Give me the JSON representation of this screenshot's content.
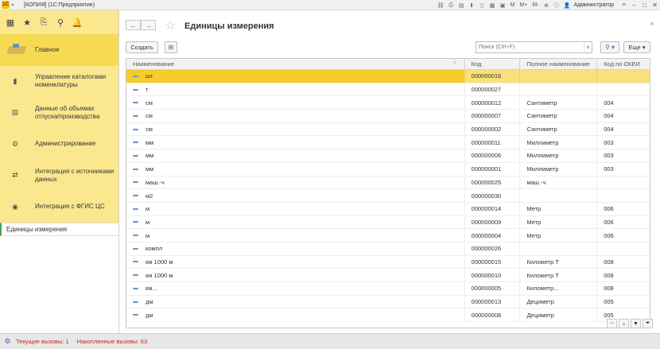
{
  "app": {
    "window_title": "[КОПИЯ]  (1С:Предприятие)",
    "user": "Администратор",
    "m_label": "M",
    "m_plus": "M+",
    "m_minus": "M-"
  },
  "sections": [
    {
      "icon": "home-logo-icon",
      "label": "Главное",
      "active": true
    },
    {
      "icon": "catalog-icon",
      "label": "Управление каталогами номенклатуры",
      "active": false
    },
    {
      "icon": "document-icon",
      "label": "Данные об объемах отпуска/производства",
      "active": false
    },
    {
      "icon": "gear-icon",
      "label": "Администрирование",
      "active": false
    },
    {
      "icon": "integration-icon",
      "label": "Интеграция с источниками данных",
      "active": false
    },
    {
      "icon": "fgis-icon",
      "label": "Интеграция с ФГИС ЦС",
      "active": false
    }
  ],
  "open_windows": [
    {
      "label": "Единицы измерения"
    }
  ],
  "form": {
    "title": "Единицы измерения",
    "create_label": "Создать",
    "search_placeholder": "Поиск (Ctrl+F)",
    "more_label": "Еще"
  },
  "table": {
    "columns": [
      "Наименование",
      "Код",
      "Полное наименование",
      "Код по ОКЕИ"
    ],
    "selected_index": 0,
    "rows": [
      {
        "name": "шт",
        "code": "000000016",
        "full": "",
        "okei": ""
      },
      {
        "name": "т",
        "code": "000000027",
        "full": "",
        "okei": ""
      },
      {
        "name": "см",
        "code": "000000012",
        "full": "Сантиметр",
        "okei": "004"
      },
      {
        "name": "см",
        "code": "000000007",
        "full": "Сантиметр",
        "okei": "004"
      },
      {
        "name": "см",
        "code": "000000002",
        "full": "Сантиметр",
        "okei": "004"
      },
      {
        "name": "мм",
        "code": "000000011",
        "full": "Миллиметр",
        "okei": "003"
      },
      {
        "name": "мм",
        "code": "000000006",
        "full": "Миллиметр",
        "okei": "003"
      },
      {
        "name": "мм",
        "code": "000000001",
        "full": "Миллиметр",
        "okei": "003"
      },
      {
        "name": "маш.-ч",
        "code": "000000025",
        "full": "маш.-ч",
        "okei": ""
      },
      {
        "name": "м2",
        "code": "000000030",
        "full": "",
        "okei": ""
      },
      {
        "name": "м",
        "code": "000000014",
        "full": "Метр",
        "okei": "006"
      },
      {
        "name": "м",
        "code": "000000009",
        "full": "Метр",
        "okei": "006"
      },
      {
        "name": "м",
        "code": "000000004",
        "full": "Метр",
        "okei": "006"
      },
      {
        "name": "компл",
        "code": "000000026",
        "full": "",
        "okei": ""
      },
      {
        "name": "км 1000 м",
        "code": "000000015",
        "full": "Километр Т",
        "okei": "008"
      },
      {
        "name": "км 1000 м",
        "code": "000000010",
        "full": "Километр Т",
        "okei": "008"
      },
      {
        "name": "км...",
        "code": "000000005",
        "full": "Километр...",
        "okei": "008"
      },
      {
        "name": "дм",
        "code": "000000013",
        "full": "Дециметр",
        "okei": "005"
      },
      {
        "name": "дм",
        "code": "000000008",
        "full": "Дециметр",
        "okei": "005"
      }
    ]
  },
  "status": {
    "current_calls": "Текущие вызовы: 1",
    "accumulated_calls": "Накопленные вызовы: 63"
  },
  "colors": {
    "section_panel": "#fbe88e",
    "selection": "#f5cc2b",
    "status_text": "#cc2222"
  }
}
